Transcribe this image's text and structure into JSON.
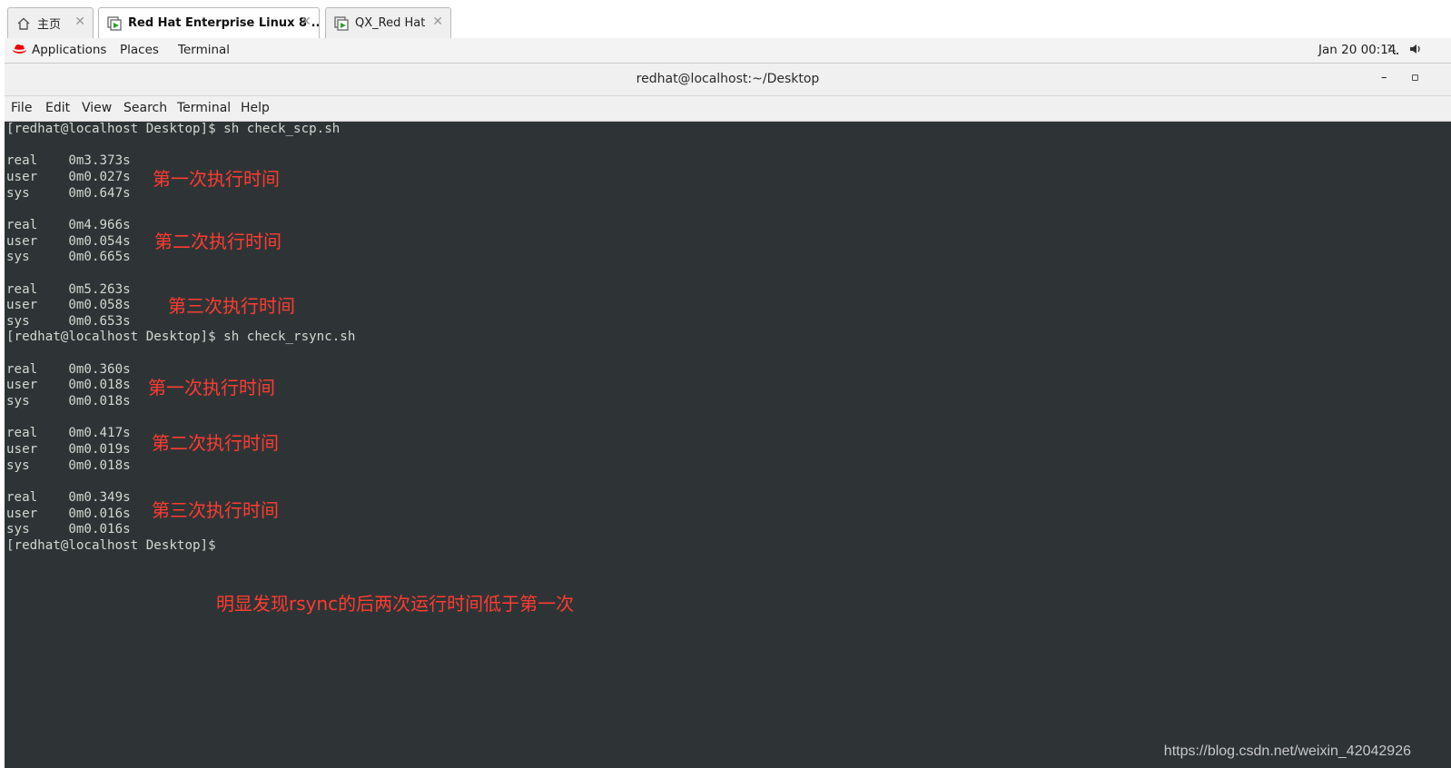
{
  "tabs": [
    {
      "label": "主页",
      "icon": "home-icon",
      "active": false
    },
    {
      "label": "Red Hat Enterprise Linux 8 ...",
      "icon": "vm-icon",
      "active": true
    },
    {
      "label": "QX_Red Hat",
      "icon": "vm-icon",
      "active": false
    }
  ],
  "tab_close_glyph": "✕",
  "topbar": {
    "applications": "Applications",
    "places": "Places",
    "terminal": "Terminal",
    "clock": "Jan 20  00:14",
    "network_icon": "network-icon",
    "volume_icon": "volume-icon"
  },
  "window": {
    "title": "redhat@localhost:~/Desktop",
    "minimize_glyph": "–",
    "maximize_glyph": "▫"
  },
  "menubar": [
    "File",
    "Edit",
    "View",
    "Search",
    "Terminal",
    "Help"
  ],
  "terminal": {
    "lines": [
      "[redhat@localhost Desktop]$ sh check_scp.sh",
      "",
      "real\t0m3.373s",
      "user\t0m0.027s",
      "sys\t0m0.647s",
      "",
      "real\t0m4.966s",
      "user\t0m0.054s",
      "sys\t0m0.665s",
      "",
      "real\t0m5.263s",
      "user\t0m0.058s",
      "sys\t0m0.653s",
      "[redhat@localhost Desktop]$ sh check_rsync.sh",
      "",
      "real\t0m0.360s",
      "user\t0m0.018s",
      "sys\t0m0.018s",
      "",
      "real\t0m0.417s",
      "user\t0m0.019s",
      "sys\t0m0.018s",
      "",
      "real\t0m0.349s",
      "user\t0m0.016s",
      "sys\t0m0.016s",
      "[redhat@localhost Desktop]$"
    ],
    "annotations": [
      "第一次执行时间",
      "第二次执行时间",
      "第三次执行时间",
      "第一次执行时间",
      "第二次执行时间",
      "第三次执行时间"
    ],
    "summary": "明显发现rsync的后两次运行时间低于第一次"
  },
  "watermark": "https://blog.csdn.net/weixin_42042926",
  "colors": {
    "terminal_bg": "#2e3436",
    "terminal_fg": "#d3d7cf",
    "annotation": "#ff3b30",
    "redhat": "#e00"
  }
}
